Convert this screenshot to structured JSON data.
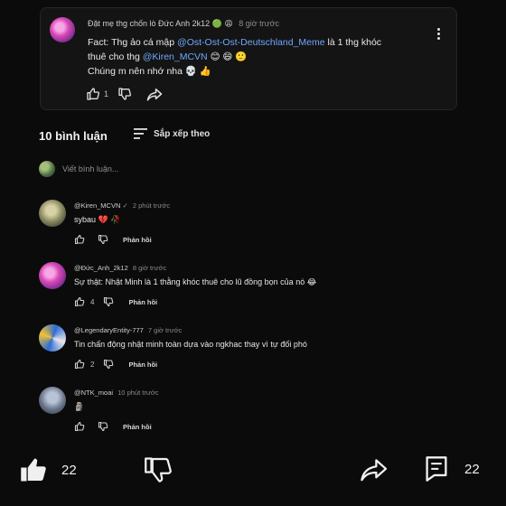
{
  "pinned": {
    "author": "Đặt mẹ thg chốn lò Đức Anh 2k12",
    "time": "8 giờ trước",
    "line1_prefix": "Fact: Thg ảo cá mập ",
    "mention1": "@Ost-Ost-Ost-Deutschland_Meme",
    "line1_suffix": " là 1 thg khóc",
    "line2_prefix": "thuê cho thg ",
    "mention2": "@Kiren_MCVN",
    "line2_suffix": " 😊 😄 🙂",
    "line3": "Chúng m nên nhớ nha 💀 👍",
    "likes": "1"
  },
  "comments_header": {
    "count_label": "10 bình luận",
    "sort_label": "Sắp xếp theo"
  },
  "compose": {
    "placeholder": "Viết bình luận..."
  },
  "comments": [
    {
      "author": "@Kiren_MCVN",
      "verified": "✓",
      "time": "2 phút trước",
      "text": "sybau 💔 🥀",
      "likes": "",
      "reply": "Phản hồi"
    },
    {
      "author": "@Đức_Anh_2k12",
      "time": "8 giờ trước",
      "text": "Sự thật: Nhật Minh là 1 thằng khóc thuê cho lũ đồng bọn của nó 😂",
      "likes": "4",
      "reply": "Phản hồi"
    },
    {
      "author": "@LegendaryEntity-777",
      "time": "7 giờ trước",
      "text": "Tin chấn động nhật minh toàn dựa vào ngkhac thay vì tự đối phó",
      "likes": "2",
      "reply": "Phản hồi"
    },
    {
      "author": "@NTK_moai",
      "time": "10 phút trước",
      "text": "🗿",
      "likes": "",
      "reply": "Phản hồi"
    }
  ],
  "bottom": {
    "like_count": "22",
    "comment_count": "22"
  }
}
